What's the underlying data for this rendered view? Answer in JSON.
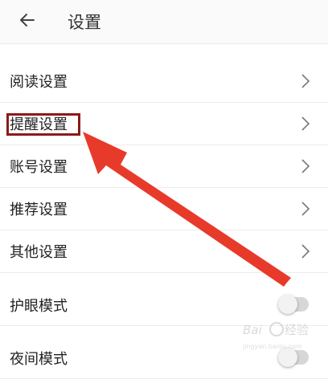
{
  "header": {
    "title": "设置",
    "back_icon": "arrow-left-icon"
  },
  "menu": [
    {
      "label": "阅读设置",
      "icon": "chevron-right-icon"
    },
    {
      "label": "提醒设置",
      "icon": "chevron-right-icon"
    },
    {
      "label": "账号设置",
      "icon": "chevron-right-icon"
    },
    {
      "label": "推荐设置",
      "icon": "chevron-right-icon"
    },
    {
      "label": "其他设置",
      "icon": "chevron-right-icon"
    }
  ],
  "toggles": [
    {
      "label": "护眼模式",
      "state": "off"
    },
    {
      "label": "夜间模式",
      "state": "off"
    }
  ],
  "annotation": {
    "highlight_color": "#8b1a1a",
    "arrow_color": "#e83a2a"
  },
  "watermark": {
    "text": "Baidu经验",
    "sub": "jingyan.baidu.com"
  }
}
